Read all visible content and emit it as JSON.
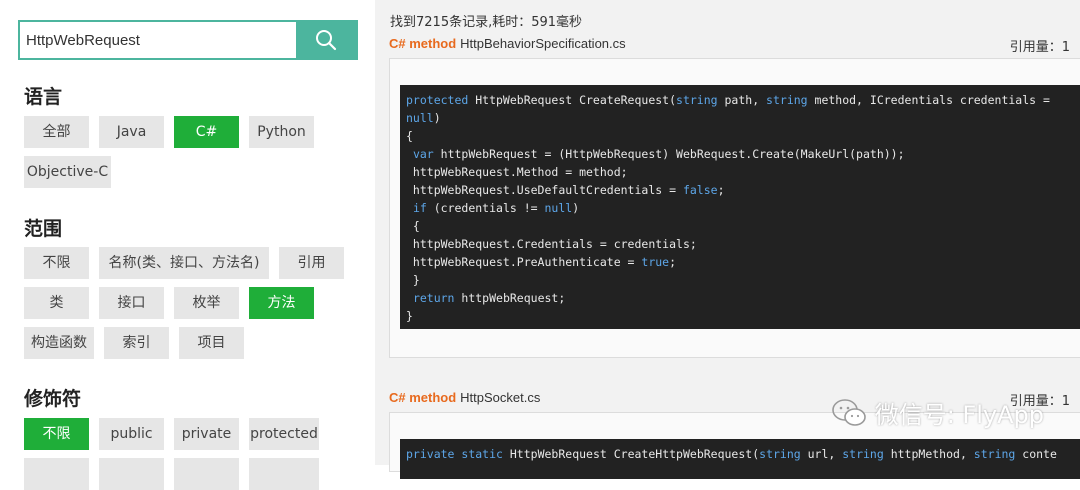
{
  "search": {
    "value": "HttpWebRequest",
    "button_icon": "search-icon"
  },
  "filters": {
    "language": {
      "title": "语言",
      "options": [
        "全部",
        "Java",
        "C#",
        "Python",
        "Objective-C"
      ],
      "selected": "C#"
    },
    "scope": {
      "title": "范围",
      "options": [
        "不限",
        "名称(类、接口、方法名)",
        "引用",
        "类",
        "接口",
        "枚举",
        "方法",
        "构造函数",
        "索引",
        "项目"
      ],
      "selected": "方法"
    },
    "modifier": {
      "title": "修饰符",
      "options": [
        "不限",
        "public",
        "private",
        "protected"
      ],
      "selected": "不限"
    }
  },
  "results": {
    "summary": "找到7215条记录,耗时：591毫秒",
    "items": [
      {
        "lang": "C# method",
        "file": "HttpBehaviorSpecification.cs",
        "refs": "引用量：1",
        "code": [
          [
            [
              "kw",
              "protected"
            ],
            [
              "t",
              " HttpWebRequest CreateRequest("
            ],
            [
              "kw",
              "string"
            ],
            [
              "t",
              " path, "
            ],
            [
              "kw",
              "string"
            ],
            [
              "t",
              " method, ICredentials credentials ="
            ]
          ],
          [
            [
              "kw",
              "null"
            ],
            [
              "t",
              ")"
            ]
          ],
          [
            [
              "t",
              "{"
            ]
          ],
          [
            [
              "t",
              " "
            ],
            [
              "kw",
              "var"
            ],
            [
              "t",
              " httpWebRequest = (HttpWebRequest) WebRequest.Create(MakeUrl(path));"
            ]
          ],
          [
            [
              "t",
              " httpWebRequest.Method = method;"
            ]
          ],
          [
            [
              "t",
              " httpWebRequest.UseDefaultCredentials = "
            ],
            [
              "kw",
              "false"
            ],
            [
              "t",
              ";"
            ]
          ],
          [
            [
              "t",
              " "
            ],
            [
              "kw",
              "if"
            ],
            [
              "t",
              " (credentials != "
            ],
            [
              "kw",
              "null"
            ],
            [
              "t",
              ")"
            ]
          ],
          [
            [
              "t",
              " {"
            ]
          ],
          [
            [
              "t",
              " httpWebRequest.Credentials = credentials;"
            ]
          ],
          [
            [
              "t",
              " httpWebRequest.PreAuthenticate = "
            ],
            [
              "kw",
              "true"
            ],
            [
              "t",
              ";"
            ]
          ],
          [
            [
              "t",
              " }"
            ]
          ],
          [
            [
              "t",
              " "
            ],
            [
              "kw",
              "return"
            ],
            [
              "t",
              " httpWebRequest;"
            ]
          ],
          [
            [
              "t",
              "}"
            ]
          ]
        ]
      },
      {
        "lang": "C# method",
        "file": "HttpSocket.cs",
        "refs": "引用量：1",
        "code": [
          [
            [
              "kw",
              "private"
            ],
            [
              "t",
              " "
            ],
            [
              "kw",
              "static"
            ],
            [
              "t",
              " HttpWebRequest CreateHttpWebRequest("
            ],
            [
              "kw",
              "string"
            ],
            [
              "t",
              " url, "
            ],
            [
              "kw",
              "string"
            ],
            [
              "t",
              " httpMethod, "
            ],
            [
              "kw",
              "string"
            ],
            [
              "t",
              " conte"
            ]
          ]
        ]
      }
    ]
  },
  "watermark": "微信号: FlyApp",
  "colors": {
    "accent": "#4cb59e",
    "active_tag": "#1fae39",
    "lang_label": "#e86a1e",
    "code_bg": "#222222",
    "keyword": "#5da6e8"
  }
}
